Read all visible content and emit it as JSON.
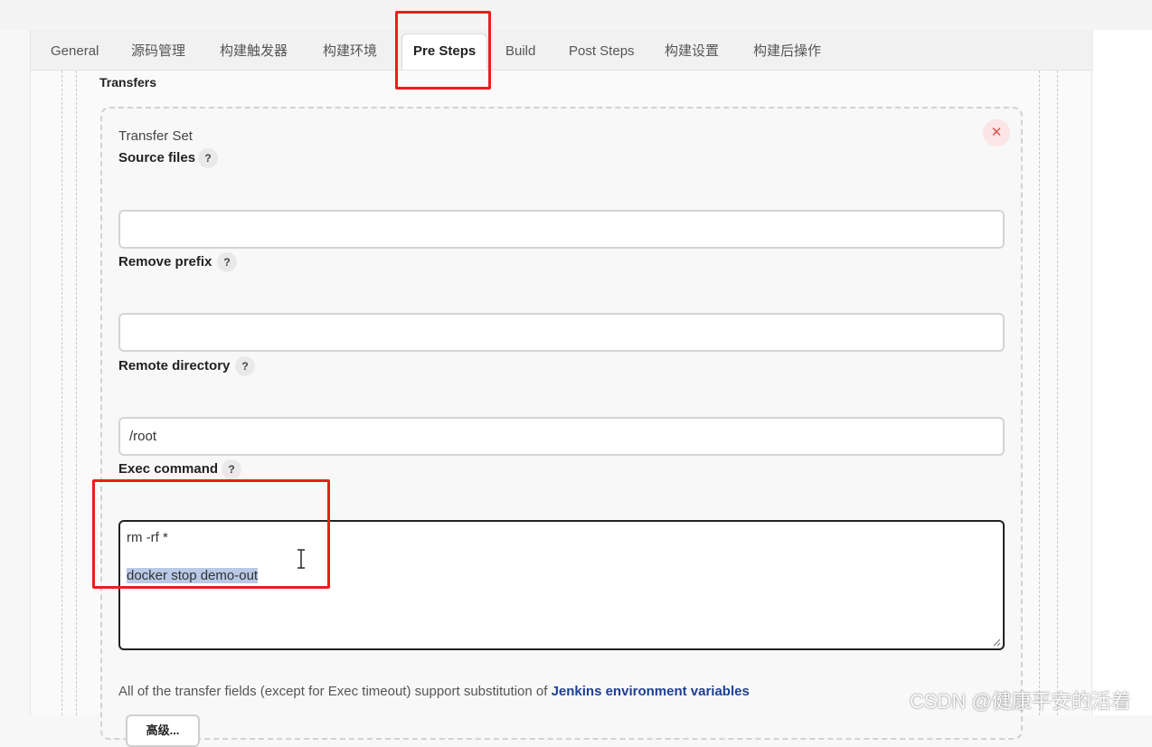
{
  "tabs": [
    {
      "label": "General"
    },
    {
      "label": "源码管理"
    },
    {
      "label": "构建触发器"
    },
    {
      "label": "构建环境"
    },
    {
      "label": "Pre Steps",
      "active": true
    },
    {
      "label": "Build"
    },
    {
      "label": "Post Steps"
    },
    {
      "label": "构建设置"
    },
    {
      "label": "构建后操作"
    }
  ],
  "transfers": {
    "section_label": "Transfers",
    "set_title": "Transfer Set",
    "remove_icon": "close-icon",
    "source_files": {
      "label": "Source files",
      "value": ""
    },
    "remove_prefix": {
      "label": "Remove prefix",
      "value": ""
    },
    "remote_directory": {
      "label": "Remote directory",
      "value": "/root"
    },
    "exec_command": {
      "label": "Exec command",
      "lines": [
        "rm -rf *",
        "docker stop demo-out"
      ],
      "selected_line": "docker stop demo-out"
    },
    "help_glyph": "?",
    "note_prefix": "All of the transfer fields (except for Exec timeout) support substitution of ",
    "note_link": "Jenkins environment variables",
    "advanced_button": "高级..."
  },
  "highlight_color": "#ee1c1c",
  "selection_color": "#b9c9e6",
  "link_color": "#1f3f94",
  "watermark": "CSDN @健康平安的活着"
}
